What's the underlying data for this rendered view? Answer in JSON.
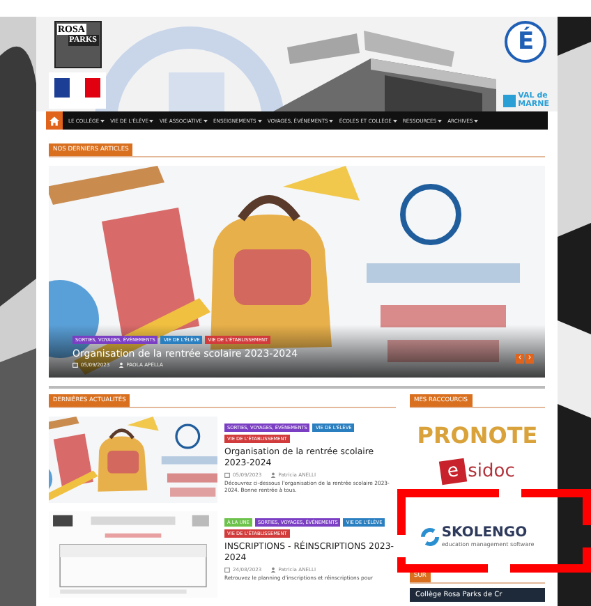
{
  "header": {
    "logo": [
      "ROSA",
      "PARKS"
    ],
    "academy_mark": "É",
    "department": [
      "VAL de",
      "MARNE"
    ]
  },
  "nav": {
    "items": [
      {
        "label": "LE COLLÈGE"
      },
      {
        "label": "VIE DE L'ÉLÈVE"
      },
      {
        "label": "VIE ASSOCIATIVE"
      },
      {
        "label": "ENSEIGNEMENTS"
      },
      {
        "label": "VOYAGES, ÉVÉNEMENTS"
      },
      {
        "label": "ÉCOLES ET COLLÈGE"
      },
      {
        "label": "RESSOURCES"
      },
      {
        "label": "ARCHIVES"
      }
    ]
  },
  "featured": {
    "heading": "NOS DERNIERS ARTICLES",
    "slide": {
      "tags": [
        {
          "label": "SORTIES, VOYAGES, ÉVÉNEMENTS",
          "color": "#7b3fc4"
        },
        {
          "label": "VIE DE L'ÉLÈVE",
          "color": "#2a7fc1"
        },
        {
          "label": "VIE DE L'ÉTABLISSEMENT",
          "color": "#d23b3b"
        }
      ],
      "title": "Organisation de la rentrée scolaire 2023-2024",
      "date": "05/09/2023",
      "author": "PAOLA APELLA"
    },
    "controls": [
      "‹",
      "›"
    ]
  },
  "news": {
    "heading": "DERNIÈRES ACTUALITÉS",
    "posts": [
      {
        "tags": [
          {
            "label": "SORTIES, VOYAGES, ÉVÉNEMENTS",
            "color": "#7b3fc4"
          },
          {
            "label": "VIE DE L'ÉLÈVE",
            "color": "#2a7fc1"
          },
          {
            "label": "VIE DE L'ÉTABLISSEMENT",
            "color": "#d23b3b"
          }
        ],
        "title": "Organisation de la rentrée scolaire 2023-2024",
        "date": "05/09/2023",
        "author": "Patricia ANELLI",
        "excerpt": "Découvrez ci-dessous l'organisation de la rentrée scolaire 2023-2024. Bonne rentrée à tous."
      },
      {
        "tags": [
          {
            "label": "À LA UNE",
            "color": "#6cc24a"
          },
          {
            "label": "SORTIES, VOYAGES, ÉVÉNEMENTS",
            "color": "#7b3fc4"
          },
          {
            "label": "VIE DE L'ÉLÈVE",
            "color": "#2a7fc1"
          },
          {
            "label": "VIE DE L'ÉTABLISSEMENT",
            "color": "#d23b3b"
          }
        ],
        "title": "INSCRIPTIONS - RÉINSCRIPTIONS 2023-2024",
        "date": "24/08/2023",
        "author": "Patricia ANELLI",
        "excerpt": "Retrouvez le planning d'inscriptions et réinscriptions pour"
      }
    ]
  },
  "shortcuts": {
    "heading": "MES RACCOURCIS",
    "links": [
      {
        "kind": "pronote",
        "label": "PRONOTE"
      },
      {
        "kind": "esidoc",
        "mark": "e",
        "label": "sidoc"
      },
      {
        "kind": "skolengo",
        "label": "SKOLENGO",
        "sub": "education management software"
      }
    ]
  },
  "follow": {
    "heading": "SUR",
    "box": "Collège Rosa Parks de Cr"
  }
}
